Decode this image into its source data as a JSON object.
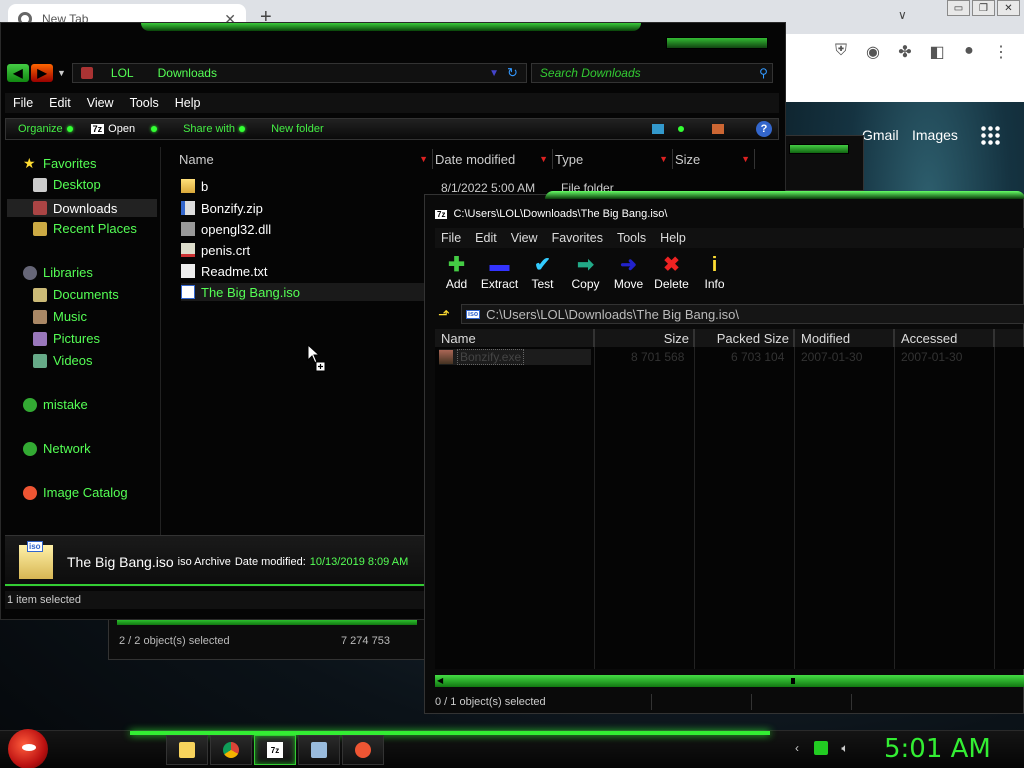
{
  "chrome": {
    "tab_title": "New Tab",
    "new_tab": "+",
    "close": "✕",
    "dropdown": "∨",
    "window_buttons": [
      "▭",
      "❐",
      "✕"
    ],
    "links": [
      "Gmail",
      "Images"
    ]
  },
  "explorer": {
    "breadcrumb": [
      "LOL",
      "Downloads"
    ],
    "search_placeholder": "Search Downloads",
    "menu": [
      "File",
      "Edit",
      "View",
      "Tools",
      "Help"
    ],
    "commands": [
      "Organize",
      "Open",
      "Share with",
      "New folder"
    ],
    "open_badge": "7z",
    "help": "?",
    "nav": {
      "favorites": "Favorites",
      "desktop": "Desktop",
      "downloads": "Downloads",
      "recent": "Recent Places",
      "libraries": "Libraries",
      "documents": "Documents",
      "music": "Music",
      "pictures": "Pictures",
      "videos": "Videos",
      "mistake": "mistake",
      "network": "Network",
      "image_catalog": "Image Catalog"
    },
    "columns": [
      "Name",
      "Date modified",
      "Type",
      "Size"
    ],
    "files": [
      "b",
      "Bonzify.zip",
      "opengl32.dll",
      "penis.crt",
      "Readme.txt",
      "The Big Bang.iso"
    ],
    "first_row_date": "8/1/2022 5:00 AM",
    "first_row_type": "File folder",
    "details": {
      "icon_badge": "iso",
      "name": "The Big Bang.iso",
      "type": "iso Archive",
      "date_label": "Date modified:",
      "date_value": "10/13/2019 8:09 AM"
    },
    "status": "1 item selected"
  },
  "behind_window": {
    "status_left": "2 / 2 object(s) selected",
    "status_right": "7 274 753"
  },
  "zip": {
    "icon": "7z",
    "title": "C:\\Users\\LOL\\Downloads\\The Big Bang.iso\\",
    "menu": [
      "File",
      "Edit",
      "View",
      "Favorites",
      "Tools",
      "Help"
    ],
    "tools": [
      {
        "label": "Add",
        "glyph": "✚"
      },
      {
        "label": "Extract",
        "glyph": "▬"
      },
      {
        "label": "Test",
        "glyph": "✔"
      },
      {
        "label": "Copy",
        "glyph": "➡"
      },
      {
        "label": "Move",
        "glyph": "➜"
      },
      {
        "label": "Delete",
        "glyph": "✖"
      },
      {
        "label": "Info",
        "glyph": "i"
      }
    ],
    "path": "C:\\Users\\LOL\\Downloads\\The Big Bang.iso\\",
    "path_badge": "iso",
    "columns": [
      "Name",
      "Size",
      "Packed Size",
      "Modified",
      "Accessed"
    ],
    "row": {
      "name": "Bonzify.exe",
      "size": "8 701 568",
      "packed": "6 703 104",
      "modified": "2007-01-30",
      "accessed": "2007-01-30"
    },
    "status": "0 / 1 object(s) selected"
  },
  "taskbar": {
    "clock": "5:01 AM",
    "zip_badge": "7z"
  }
}
